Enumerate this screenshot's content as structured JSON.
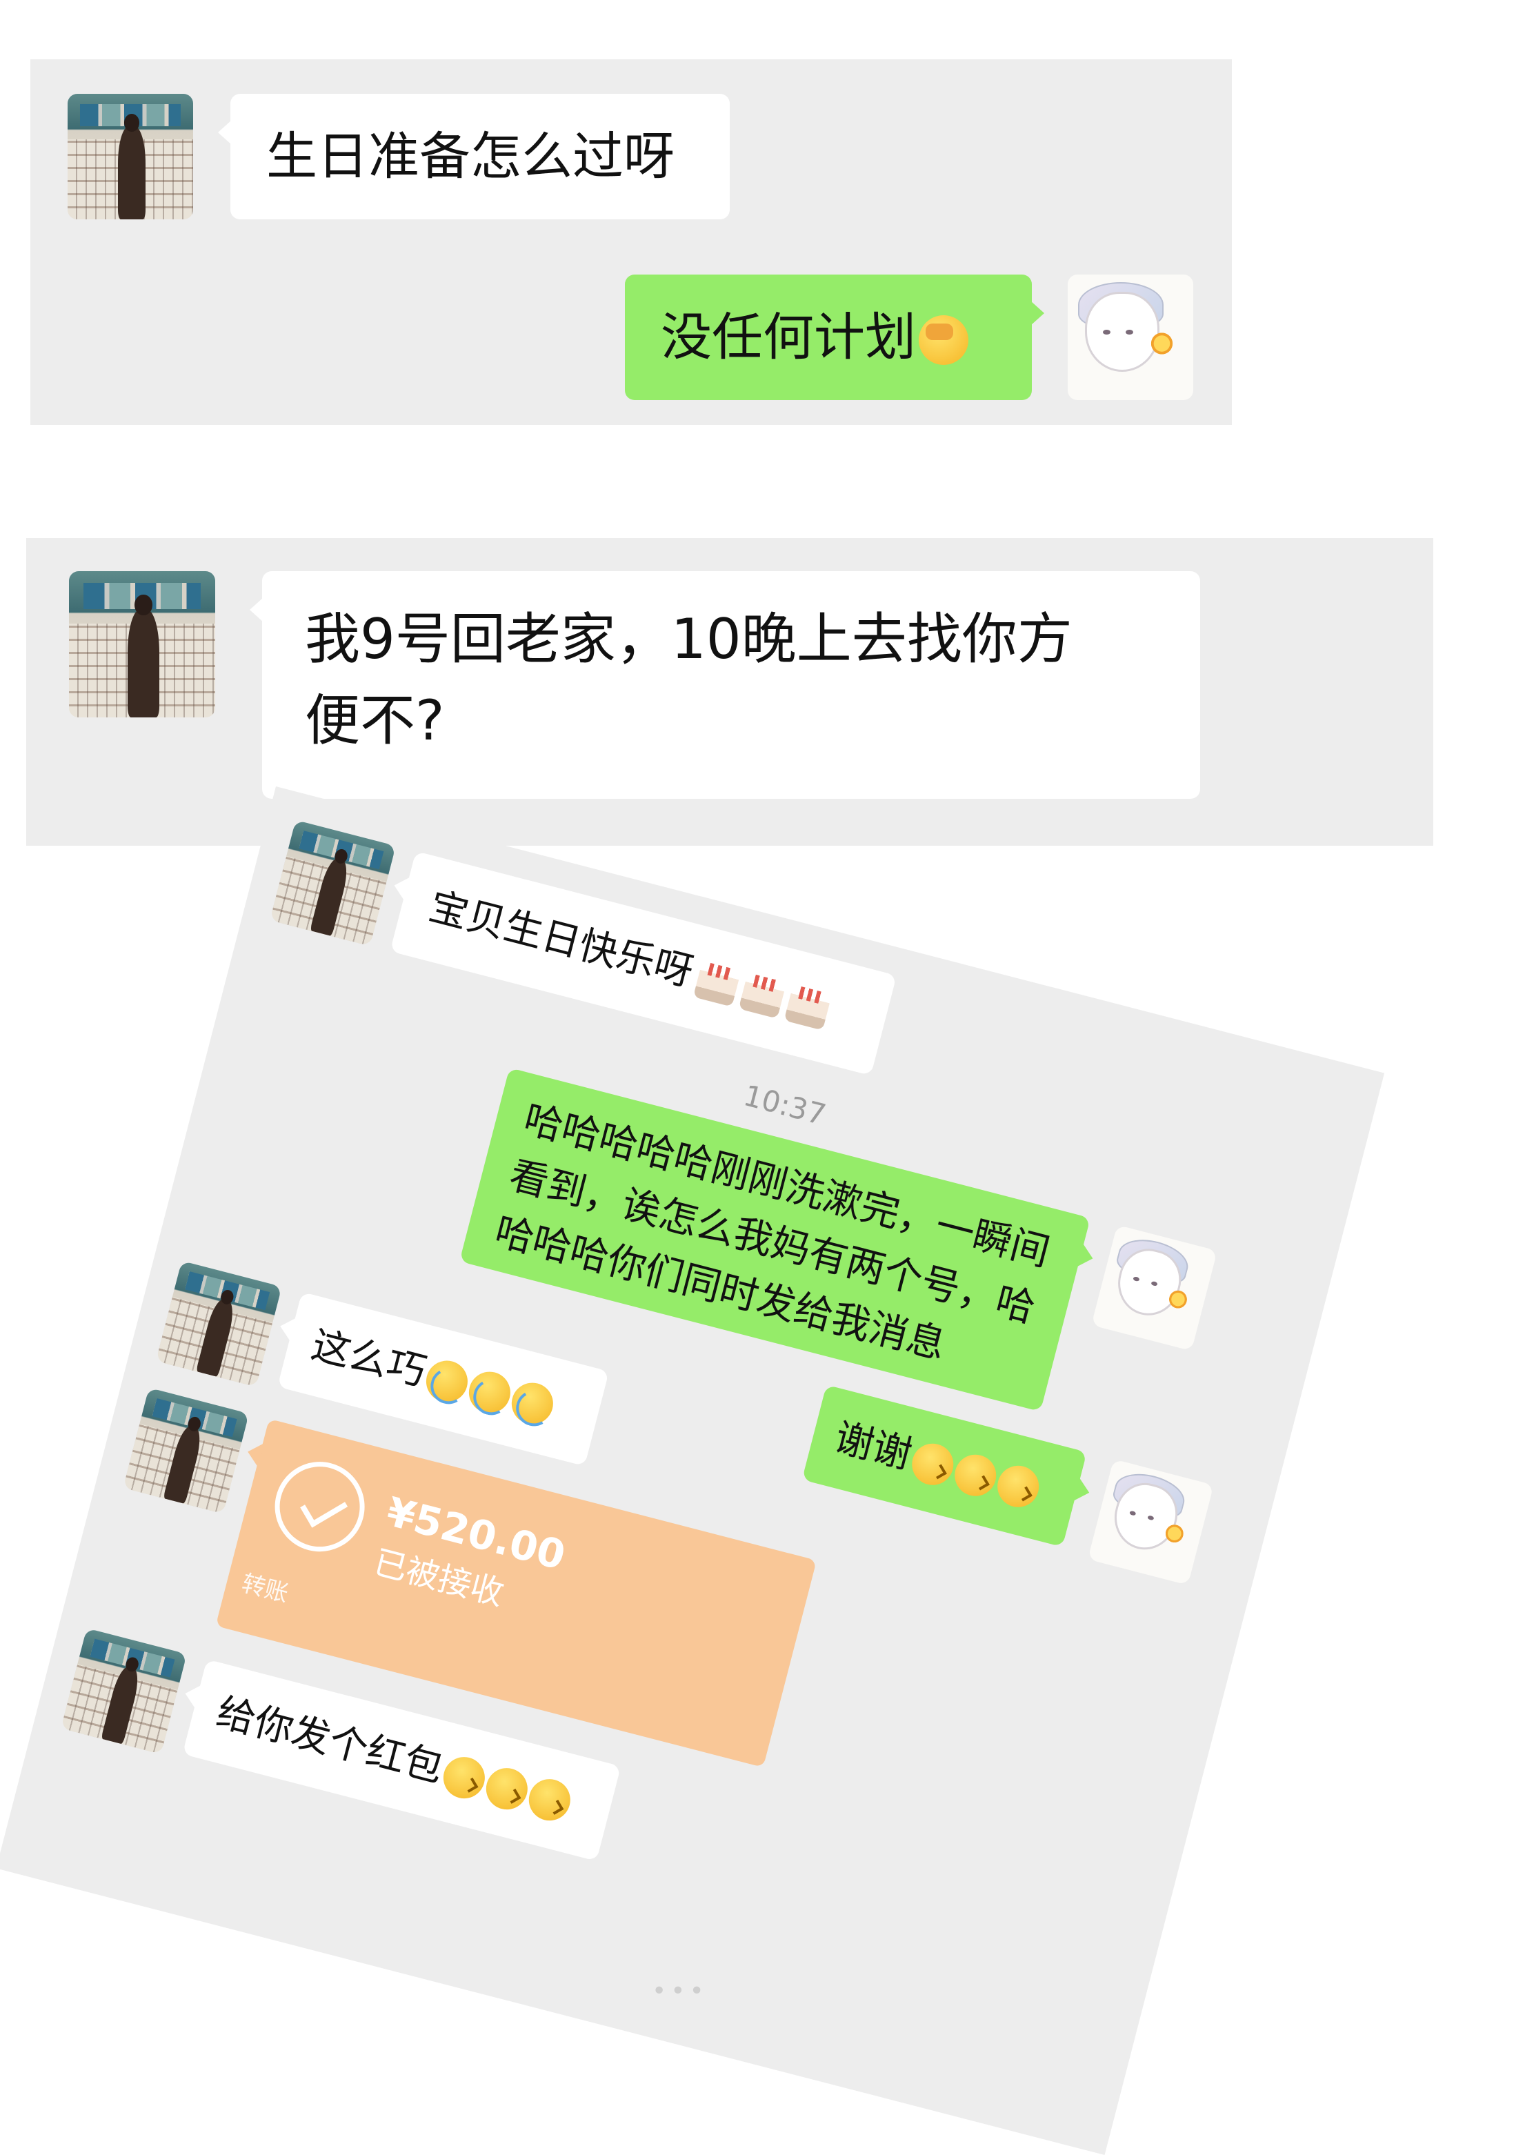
{
  "chat_top": {
    "incoming": {
      "text": "生日准备怎么过呀"
    },
    "outgoing": {
      "text": "没任何计划",
      "emoji_icon": "face-palm-icon"
    }
  },
  "chat_middle": {
    "incoming": {
      "text_line1": "我9号回老家，10晚上去找你方",
      "text_line2": "便不?"
    }
  },
  "rotated_chat": {
    "msg1": {
      "text": "宝贝生日快乐呀",
      "emoji_icons": [
        "cake-icon",
        "cake-icon",
        "cake-icon"
      ]
    },
    "time": "10:37",
    "msg2": {
      "line1": "哈哈哈哈哈刚刚洗漱完，一瞬间",
      "line2": "看到，诶怎么我妈有两个号，哈",
      "line3": "哈哈哈你们同时发给我消息"
    },
    "msg3": {
      "text": "谢谢",
      "emoji_icons": [
        "kiss-icon",
        "kiss-icon",
        "kiss-icon"
      ]
    },
    "msg4": {
      "text": "这么巧",
      "emoji_icons": [
        "tears-of-joy-icon",
        "tears-of-joy-icon",
        "tears-of-joy-icon"
      ]
    },
    "transfer": {
      "amount": "¥520.00",
      "status": "已被接收",
      "label": "转账"
    },
    "msg5": {
      "text": "给你发个红包",
      "emoji_icons": [
        "kiss-icon",
        "kiss-icon",
        "kiss-icon"
      ]
    }
  }
}
